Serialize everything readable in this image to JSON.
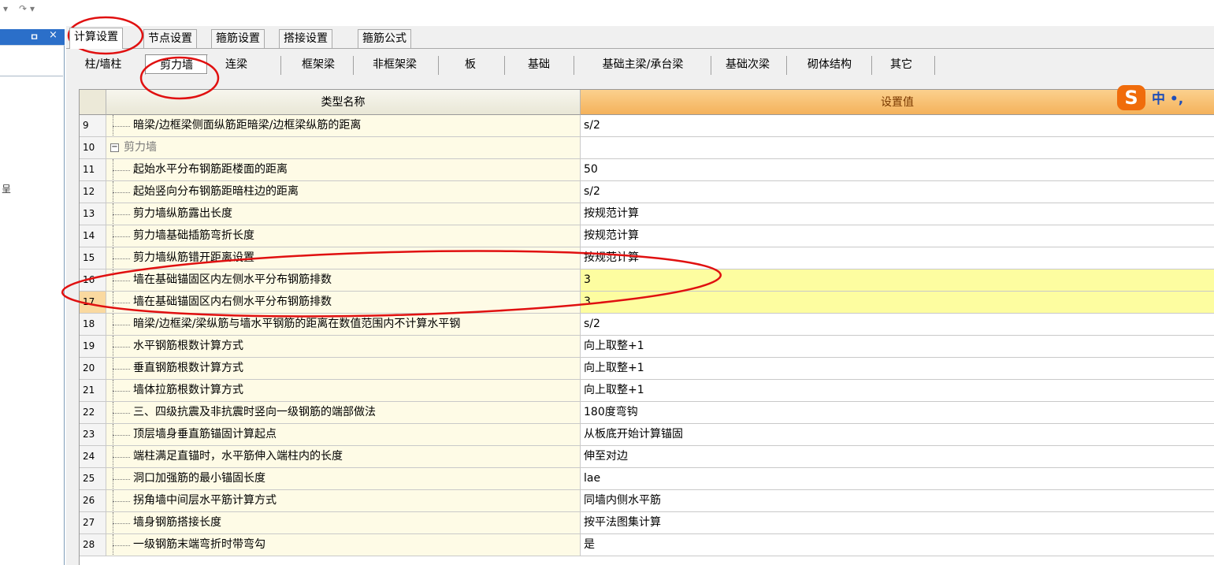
{
  "quickbar": {
    "dropdown_glyph": "▾",
    "redo_glyph": "↷",
    "redo_dropdown_glyph": "▾"
  },
  "left_pane": {
    "pin_glyph": "ㅁ",
    "close_glyph": "×",
    "glyph": "呈"
  },
  "tabs": [
    {
      "label": "计算设置",
      "active": true
    },
    {
      "label": "节点设置",
      "active": false
    },
    {
      "label": "箍筋设置",
      "active": false
    },
    {
      "label": "搭接设置",
      "active": false
    },
    {
      "label": "箍筋公式",
      "active": false
    }
  ],
  "subtabs": [
    {
      "label": "柱/墙柱",
      "active": false
    },
    {
      "label": "剪力墙",
      "active": true
    },
    {
      "label": "连梁",
      "active": false
    },
    {
      "label": "框架梁",
      "active": false
    },
    {
      "label": "非框架梁",
      "active": false
    },
    {
      "label": "板",
      "active": false
    },
    {
      "label": "基础",
      "active": false
    },
    {
      "label": "基础主梁/承台梁",
      "active": false
    },
    {
      "label": "基础次梁",
      "active": false
    },
    {
      "label": "砌体结构",
      "active": false
    },
    {
      "label": "其它",
      "active": false
    }
  ],
  "grid": {
    "header": {
      "name": "类型名称",
      "value": "设置值"
    },
    "rows": [
      {
        "num": "9",
        "name": "暗梁/边框梁侧面纵筋距暗梁/边框梁纵筋的距离",
        "value": "s/2",
        "type": "item"
      },
      {
        "num": "10",
        "name": "剪力墙",
        "value": "",
        "type": "group",
        "toggle": "−"
      },
      {
        "num": "11",
        "name": "起始水平分布钢筋距楼面的距离",
        "value": "50",
        "type": "item"
      },
      {
        "num": "12",
        "name": "起始竖向分布钢筋距暗柱边的距离",
        "value": "s/2",
        "type": "item"
      },
      {
        "num": "13",
        "name": "剪力墙纵筋露出长度",
        "value": "按规范计算",
        "type": "item"
      },
      {
        "num": "14",
        "name": "剪力墙基础插筋弯折长度",
        "value": "按规范计算",
        "type": "item"
      },
      {
        "num": "15",
        "name": "剪力墙纵筋错开距离设置",
        "value": "按规范计算",
        "type": "item"
      },
      {
        "num": "16",
        "name": "墙在基础锚固区内左侧水平分布钢筋排数",
        "value": "3",
        "type": "item",
        "highlight": true
      },
      {
        "num": "17",
        "name": "墙在基础锚固区内右侧水平分布钢筋排数",
        "value": "3",
        "type": "item",
        "highlight": true,
        "selected": true
      },
      {
        "num": "18",
        "name": "暗梁/边框梁/梁纵筋与墙水平钢筋的距离在数值范围内不计算水平钢",
        "value": "s/2",
        "type": "item"
      },
      {
        "num": "19",
        "name": "水平钢筋根数计算方式",
        "value": "向上取整+1",
        "type": "item"
      },
      {
        "num": "20",
        "name": "垂直钢筋根数计算方式",
        "value": "向上取整+1",
        "type": "item"
      },
      {
        "num": "21",
        "name": "墙体拉筋根数计算方式",
        "value": "向上取整+1",
        "type": "item"
      },
      {
        "num": "22",
        "name": "三、四级抗震及非抗震时竖向一级钢筋的端部做法",
        "value": "180度弯钩",
        "type": "item"
      },
      {
        "num": "23",
        "name": "顶层墙身垂直筋锚固计算起点",
        "value": "从板底开始计算锚固",
        "type": "item"
      },
      {
        "num": "24",
        "name": "端柱满足直锚时，水平筋伸入端柱内的长度",
        "value": "伸至对边",
        "type": "item"
      },
      {
        "num": "25",
        "name": "洞口加强筋的最小锚固长度",
        "value": "lae",
        "type": "item"
      },
      {
        "num": "26",
        "name": "拐角墙中间层水平筋计算方式",
        "value": "同墙内侧水平筋",
        "type": "item"
      },
      {
        "num": "27",
        "name": "墙身钢筋搭接长度",
        "value": "按平法图集计算",
        "type": "item"
      },
      {
        "num": "28",
        "name": "一级钢筋末端弯折时带弯勾",
        "value": "是",
        "type": "item"
      }
    ]
  },
  "ime": {
    "logo": "S",
    "text": "中 •,"
  },
  "colors": {
    "header_value_bg": "#f4b25b",
    "highlight_value_bg": "#fdfda0",
    "name_column_bg": "#fefbe6",
    "annotation": "#e01010",
    "ime_logo": "#f06c0b"
  }
}
